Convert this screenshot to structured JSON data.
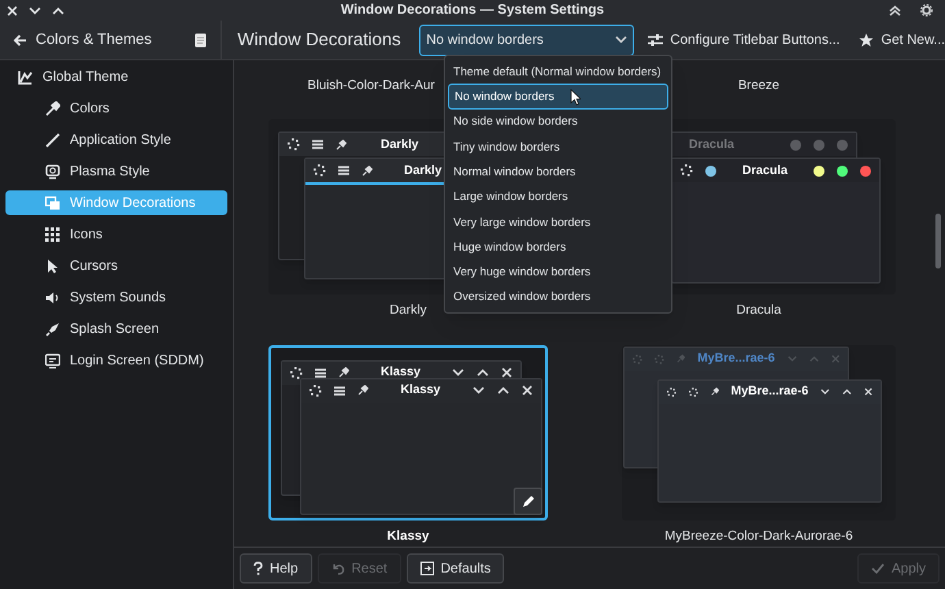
{
  "window": {
    "title": "Window Decorations — System Settings"
  },
  "sidebar": {
    "back_label": "Colors & Themes",
    "items": [
      {
        "label": "Global Theme",
        "selected": false,
        "children": [
          {
            "label": "Colors",
            "selected": false
          },
          {
            "label": "Application Style",
            "selected": false
          },
          {
            "label": "Plasma Style",
            "selected": false
          },
          {
            "label": "Window Decorations",
            "selected": true
          },
          {
            "label": "Icons",
            "selected": false
          },
          {
            "label": "Cursors",
            "selected": false
          },
          {
            "label": "System Sounds",
            "selected": false
          },
          {
            "label": "Splash Screen",
            "selected": false
          },
          {
            "label": "Login Screen (SDDM)",
            "selected": false
          }
        ]
      }
    ]
  },
  "page": {
    "title": "Window Decorations",
    "border_size": {
      "value": "No window borders",
      "expanded": true,
      "options": [
        {
          "label": "Theme default (Normal window borders)",
          "selected": false
        },
        {
          "label": "No window borders",
          "selected": true
        },
        {
          "label": "No side window borders",
          "selected": false
        },
        {
          "label": "Tiny window borders",
          "selected": false
        },
        {
          "label": "Normal window borders",
          "selected": false
        },
        {
          "label": "Large window borders",
          "selected": false
        },
        {
          "label": "Very large window borders",
          "selected": false
        },
        {
          "label": "Huge window borders",
          "selected": false
        },
        {
          "label": "Very huge window borders",
          "selected": false
        },
        {
          "label": "Oversized window borders",
          "selected": false
        }
      ]
    },
    "actions": [
      {
        "label": "Configure Titlebar Buttons...",
        "kind": "configure"
      },
      {
        "label": "Get New...",
        "kind": "get-new"
      }
    ]
  },
  "decorations": [
    {
      "name": "Bluish-Color-Dark-Aur",
      "selected": false
    },
    {
      "name": "Breeze",
      "selected": false
    },
    {
      "name": "Darkly",
      "selected": false,
      "preview": {
        "kind": "darkly",
        "back_title": "Darkly",
        "front_title": "Darkly"
      }
    },
    {
      "name": "Dracula",
      "selected": false,
      "preview": {
        "kind": "dracula",
        "back_title": "Dracula",
        "front_title": "Dracula"
      }
    },
    {
      "name": "Klassy",
      "selected": true,
      "preview": {
        "kind": "klassy",
        "back_title": "Klassy",
        "front_title": "Klassy"
      }
    },
    {
      "name": "MyBreeze-Color-Dark-Aurorae-6",
      "selected": false,
      "preview": {
        "kind": "mybreeze",
        "back_title": "MyBre...rae-6",
        "front_title": "MyBre...rae-6"
      }
    }
  ],
  "buttons": [
    {
      "label": "Help",
      "kind": "help",
      "disabled": false
    },
    {
      "label": "Reset",
      "kind": "reset",
      "disabled": true
    },
    {
      "label": "Defaults",
      "kind": "defaults",
      "disabled": false
    },
    {
      "label": "Apply",
      "kind": "apply",
      "disabled": true
    }
  ]
}
